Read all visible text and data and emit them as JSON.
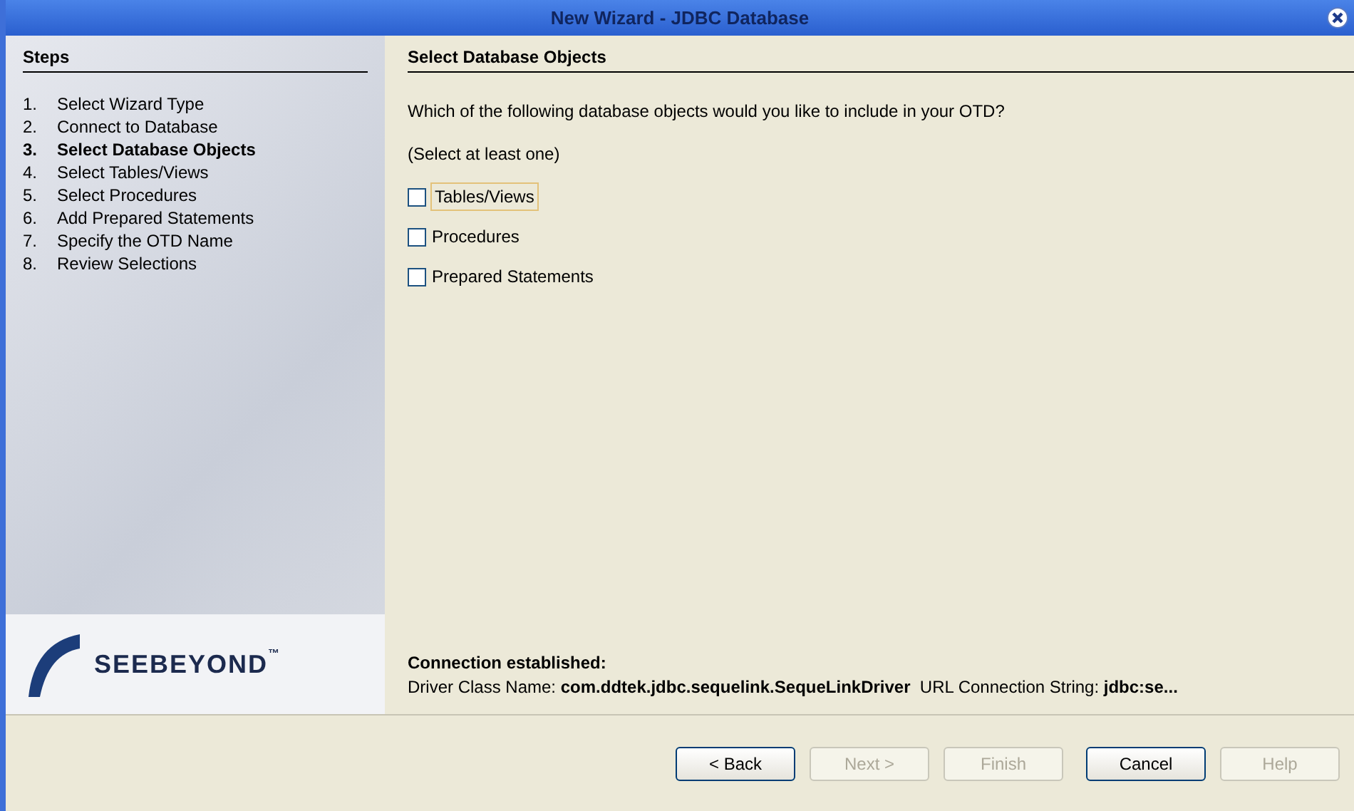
{
  "window": {
    "title": "New Wizard - JDBC Database"
  },
  "steps": {
    "heading": "Steps",
    "items": [
      {
        "number": "1.",
        "label": "Select Wizard Type",
        "selected": false
      },
      {
        "number": "2.",
        "label": "Connect to Database",
        "selected": false
      },
      {
        "number": "3.",
        "label": "Select Database Objects",
        "selected": true
      },
      {
        "number": "4.",
        "label": "Select Tables/Views",
        "selected": false
      },
      {
        "number": "5.",
        "label": "Select Procedures",
        "selected": false
      },
      {
        "number": "6.",
        "label": "Add Prepared Statements",
        "selected": false
      },
      {
        "number": "7.",
        "label": "Specify the OTD Name",
        "selected": false
      },
      {
        "number": "8.",
        "label": "Review Selections",
        "selected": false
      }
    ]
  },
  "logo": {
    "text": "SEEBEYOND",
    "mark": "™"
  },
  "page": {
    "heading": "Select Database Objects",
    "question": "Which of the following database objects would you like to include in your OTD?",
    "hint": "(Select at least one)",
    "options": [
      {
        "label": "Tables/Views",
        "checked": false,
        "focused": true
      },
      {
        "label": "Procedures",
        "checked": false,
        "focused": false
      },
      {
        "label": "Prepared Statements",
        "checked": false,
        "focused": false
      }
    ]
  },
  "connection": {
    "status": "Connection established:",
    "driver_label": "Driver Class Name:",
    "driver_value": "com.ddtek.jdbc.sequelink.SequeLinkDriver",
    "url_label": "URL Connection String:",
    "url_value": "jdbc:se..."
  },
  "buttons": [
    {
      "label": "< Back",
      "disabled": false
    },
    {
      "label": "Next >",
      "disabled": true
    },
    {
      "label": "Finish",
      "disabled": true
    },
    {
      "label": "Cancel",
      "disabled": false
    },
    {
      "label": "Help",
      "disabled": true
    }
  ]
}
